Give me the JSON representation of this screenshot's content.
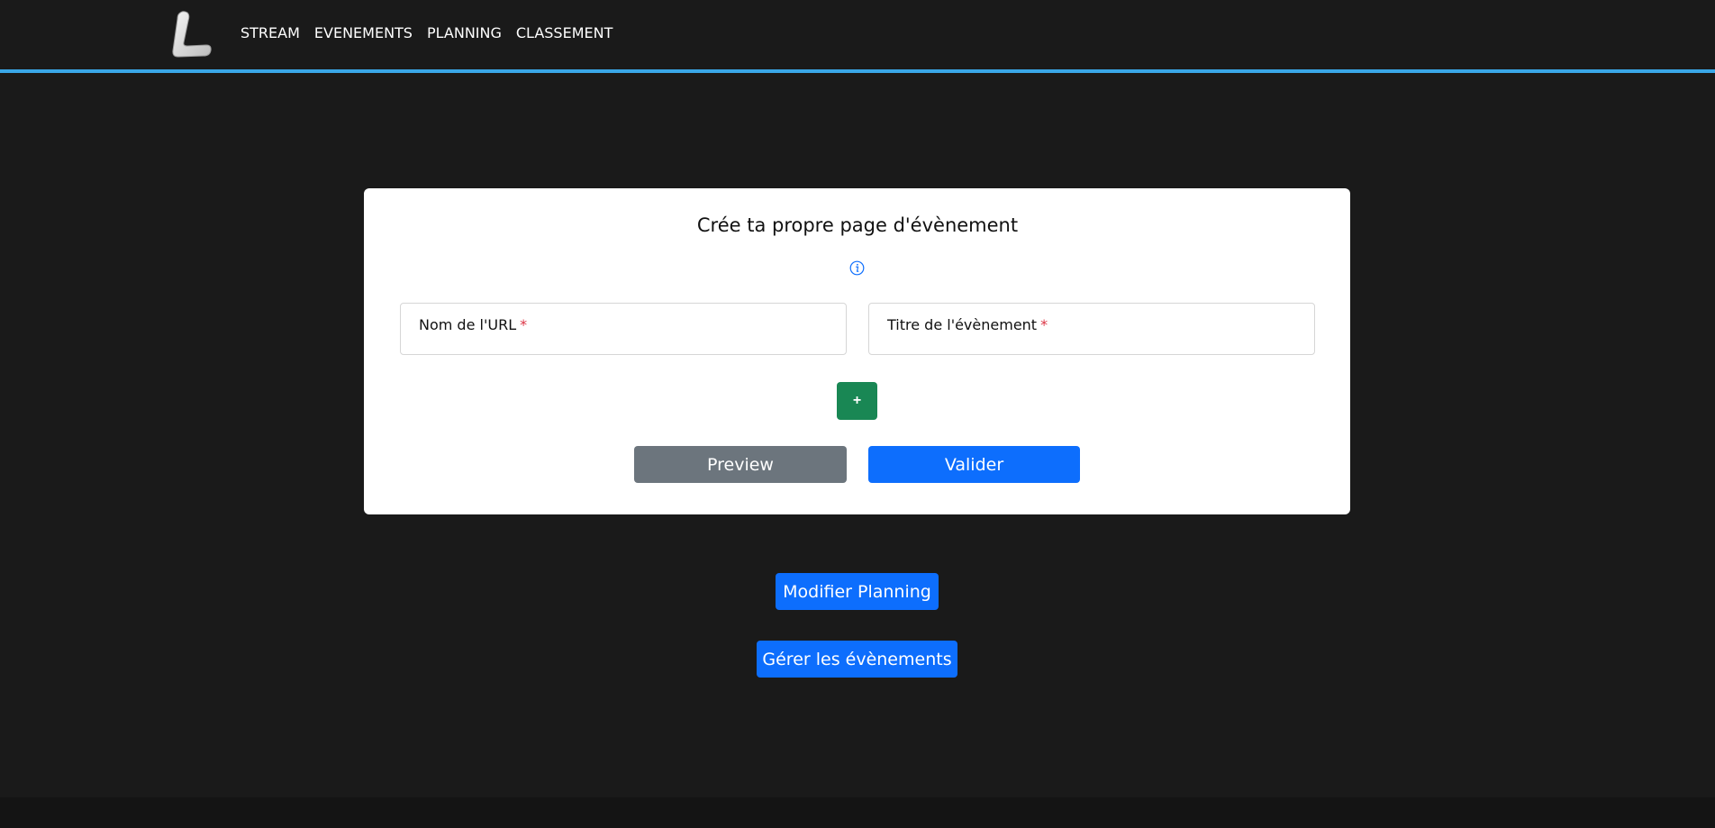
{
  "nav": {
    "logo": "L",
    "links": [
      "STREAM",
      "EVENEMENTS",
      "PLANNING",
      "CLASSEMENT"
    ]
  },
  "form": {
    "title": "Crée ta propre page d'évènement",
    "info_icon": "info-icon",
    "url_label": "Nom de l'URL",
    "event_title_label": "Titre de l'évènement",
    "required_marker": "*",
    "url_value": "",
    "event_title_value": "",
    "add_symbol": "+",
    "preview_label": "Preview",
    "submit_label": "Valider"
  },
  "actions": {
    "edit_planning_label": "Modifier Planning",
    "manage_events_label": "Gérer les évènements"
  },
  "colors": {
    "accent_bar": "#3aa7e8",
    "primary": "#0d6efd",
    "secondary": "#6c757d",
    "success": "#198754",
    "required": "#dc3545",
    "background": "#1a1a1a"
  }
}
